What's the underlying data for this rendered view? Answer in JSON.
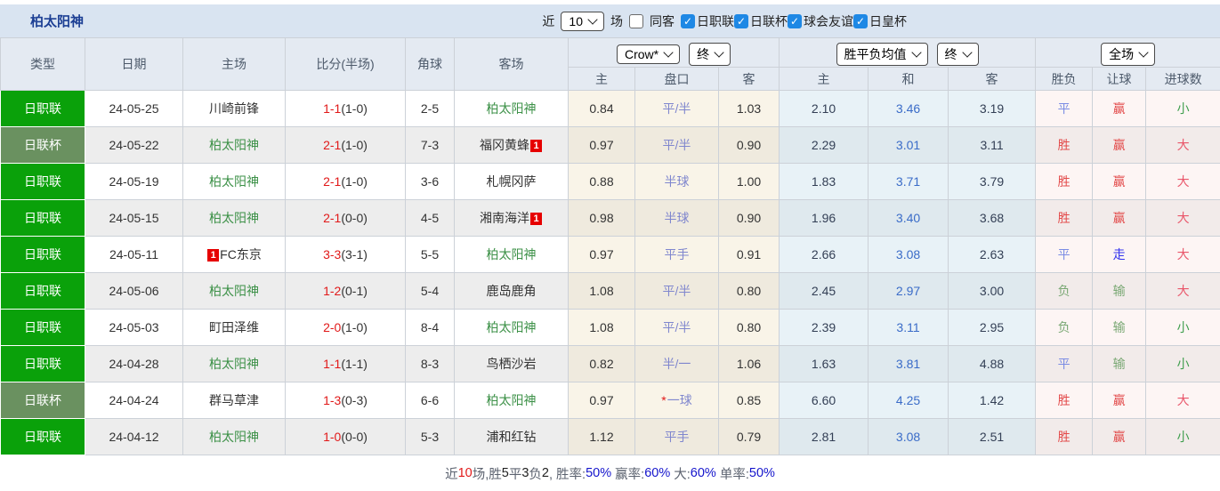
{
  "topbar": {
    "team_name": "柏太阳神",
    "recent_label": "近",
    "recent_count": "10",
    "unit_label": "场",
    "same_away_label": "同客",
    "same_away_checked": false,
    "leagues": [
      {
        "label": "日职联",
        "checked": true
      },
      {
        "label": "日联杯",
        "checked": true
      },
      {
        "label": "球会友谊",
        "checked": true
      },
      {
        "label": "日皇杯",
        "checked": true
      }
    ]
  },
  "header": {
    "cols": [
      "类型",
      "日期",
      "主场",
      "比分(半场)",
      "角球",
      "客场"
    ],
    "bookmaker": "Crow*",
    "odds_time": "终",
    "mean_label": "胜平负均值",
    "mean_time": "终",
    "scope": "全场",
    "sub": [
      "主",
      "盘口",
      "客",
      "主",
      "和",
      "客",
      "胜负",
      "让球",
      "进球数"
    ]
  },
  "rows": [
    {
      "league": "日职联",
      "muted": false,
      "date": "24-05-25",
      "home": "川崎前锋",
      "home_green": false,
      "score": "1-1",
      "half": "(1-0)",
      "corners": "2-5",
      "away": "柏太阳神",
      "away_green": true,
      "odds": [
        "0.84",
        "平/半",
        "1.03"
      ],
      "handicap_star": false,
      "mean": [
        "2.10",
        "3.46",
        "3.19"
      ],
      "res": [
        "平",
        "赢",
        "小"
      ]
    },
    {
      "league": "日联杯",
      "muted": true,
      "date": "24-05-22",
      "home": "柏太阳神",
      "home_green": true,
      "score": "2-1",
      "half": "(1-0)",
      "corners": "7-3",
      "away": "福冈黄蜂",
      "away_green": false,
      "away_badge": "1",
      "away_badge_pos": "after",
      "odds": [
        "0.97",
        "平/半",
        "0.90"
      ],
      "handicap_star": false,
      "mean": [
        "2.29",
        "3.01",
        "3.11"
      ],
      "res": [
        "胜",
        "赢",
        "大"
      ]
    },
    {
      "league": "日职联",
      "muted": false,
      "date": "24-05-19",
      "home": "柏太阳神",
      "home_green": true,
      "score": "2-1",
      "half": "(1-0)",
      "corners": "3-6",
      "away": "札幌冈萨",
      "away_green": false,
      "odds": [
        "0.88",
        "半球",
        "1.00"
      ],
      "handicap_star": false,
      "mean": [
        "1.83",
        "3.71",
        "3.79"
      ],
      "res": [
        "胜",
        "赢",
        "大"
      ]
    },
    {
      "league": "日职联",
      "muted": false,
      "date": "24-05-15",
      "home": "柏太阳神",
      "home_green": true,
      "score": "2-1",
      "half": "(0-0)",
      "corners": "4-5",
      "away": "湘南海洋",
      "away_green": false,
      "away_badge": "1",
      "away_badge_pos": "after",
      "odds": [
        "0.98",
        "半球",
        "0.90"
      ],
      "handicap_star": false,
      "mean": [
        "1.96",
        "3.40",
        "3.68"
      ],
      "res": [
        "胜",
        "赢",
        "大"
      ]
    },
    {
      "league": "日职联",
      "muted": false,
      "date": "24-05-11",
      "home": "FC东京",
      "home_green": false,
      "home_badge": "1",
      "home_badge_pos": "before",
      "score": "3-3",
      "half": "(3-1)",
      "corners": "5-5",
      "away": "柏太阳神",
      "away_green": true,
      "odds": [
        "0.97",
        "平手",
        "0.91"
      ],
      "handicap_star": false,
      "mean": [
        "2.66",
        "3.08",
        "2.63"
      ],
      "res": [
        "平",
        "走",
        "大"
      ]
    },
    {
      "league": "日职联",
      "muted": false,
      "date": "24-05-06",
      "home": "柏太阳神",
      "home_green": true,
      "score": "1-2",
      "half": "(0-1)",
      "corners": "5-4",
      "away": "鹿岛鹿角",
      "away_green": false,
      "odds": [
        "1.08",
        "平/半",
        "0.80"
      ],
      "handicap_star": false,
      "mean": [
        "2.45",
        "2.97",
        "3.00"
      ],
      "res": [
        "负",
        "输",
        "大"
      ]
    },
    {
      "league": "日职联",
      "muted": false,
      "date": "24-05-03",
      "home": "町田泽维",
      "home_green": false,
      "score": "2-0",
      "half": "(1-0)",
      "corners": "8-4",
      "away": "柏太阳神",
      "away_green": true,
      "odds": [
        "1.08",
        "平/半",
        "0.80"
      ],
      "handicap_star": false,
      "mean": [
        "2.39",
        "3.11",
        "2.95"
      ],
      "res": [
        "负",
        "输",
        "小"
      ]
    },
    {
      "league": "日职联",
      "muted": false,
      "date": "24-04-28",
      "home": "柏太阳神",
      "home_green": true,
      "score": "1-1",
      "half": "(1-1)",
      "corners": "8-3",
      "away": "鸟栖沙岩",
      "away_green": false,
      "odds": [
        "0.82",
        "半/一",
        "1.06"
      ],
      "handicap_star": false,
      "mean": [
        "1.63",
        "3.81",
        "4.88"
      ],
      "res": [
        "平",
        "输",
        "小"
      ]
    },
    {
      "league": "日联杯",
      "muted": true,
      "date": "24-04-24",
      "home": "群马草津",
      "home_green": false,
      "score": "1-3",
      "half": "(0-3)",
      "corners": "6-6",
      "away": "柏太阳神",
      "away_green": true,
      "odds": [
        "0.97",
        "一球",
        "0.85"
      ],
      "handicap_star": true,
      "mean": [
        "6.60",
        "4.25",
        "1.42"
      ],
      "res": [
        "胜",
        "赢",
        "大"
      ]
    },
    {
      "league": "日职联",
      "muted": false,
      "date": "24-04-12",
      "home": "柏太阳神",
      "home_green": true,
      "score": "1-0",
      "half": "(0-0)",
      "corners": "5-3",
      "away": "浦和红钻",
      "away_green": false,
      "odds": [
        "1.12",
        "平手",
        "0.79"
      ],
      "handicap_star": false,
      "mean": [
        "2.81",
        "3.08",
        "2.51"
      ],
      "res": [
        "胜",
        "赢",
        "小"
      ]
    }
  ],
  "footer_segments": [
    {
      "text": "近",
      "color": "#5c6370"
    },
    {
      "text": "10",
      "color": "#e11919"
    },
    {
      "text": "场,胜",
      "color": "#5c6370"
    },
    {
      "text": "5",
      "color": "#222222"
    },
    {
      "text": "平",
      "color": "#5c6370"
    },
    {
      "text": "3",
      "color": "#222222"
    },
    {
      "text": "负",
      "color": "#5c6370"
    },
    {
      "text": "2",
      "color": "#222222"
    },
    {
      "text": ", 胜率:",
      "color": "#5c6370"
    },
    {
      "text": "50%",
      "color": "#1414cc"
    },
    {
      "text": " 赢率:",
      "color": "#5c6370"
    },
    {
      "text": "60%",
      "color": "#1414cc"
    },
    {
      "text": " 大:",
      "color": "#5c6370"
    },
    {
      "text": "60%",
      "color": "#1414cc"
    },
    {
      "text": " 单率:",
      "color": "#5c6370"
    },
    {
      "text": "50%",
      "color": "#1414cc"
    }
  ],
  "value_colors": {
    "胜": "#e34b4b",
    "平": "#7b8ce4",
    "负": "#7aa874",
    "赢": "#e34b4b",
    "走": "#3333ee",
    "输": "#7aa874",
    "大": "#e9566a",
    "小": "#3f9e4d"
  },
  "palette": {
    "league_bright_green": "#0aa10a",
    "league_muted_green": "#6a9160",
    "team_green": "#3d9148",
    "score_red": "#e11919",
    "handicap_text": "#8087ce",
    "mean_draw_blue": "#3a6cc8",
    "checkbox_blue": "#1e88e5",
    "topbar_bg": "#d9e4f1",
    "header_bg": "#e4eaf2"
  }
}
